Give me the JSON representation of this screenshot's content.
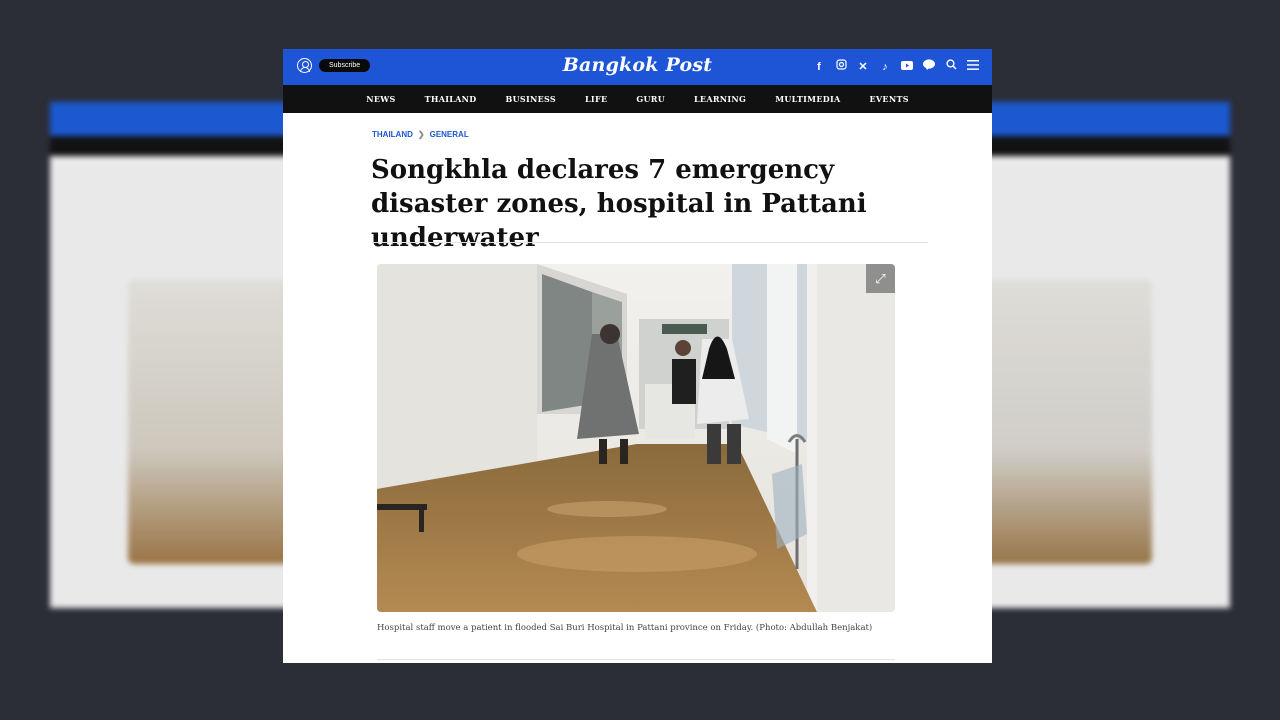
{
  "header": {
    "subscribe_label": "Subscribe",
    "logo": "Bangkok Post",
    "social_icons": [
      "facebook-icon",
      "instagram-icon",
      "x-icon",
      "tiktok-icon",
      "youtube-icon",
      "line-icon",
      "search-icon",
      "menu-icon"
    ]
  },
  "nav": {
    "items": [
      "NEWS",
      "THAILAND",
      "BUSINESS",
      "LIFE",
      "GURU",
      "LEARNING",
      "MULTIMEDIA",
      "EVENTS"
    ]
  },
  "breadcrumb": {
    "section": "THAILAND",
    "subsection": "GENERAL"
  },
  "article": {
    "headline": "Songkhla declares 7 emergency disaster zones, hospital in Pattani underwater",
    "caption": "Hospital staff move a patient in flooded Sai Buri Hospital in Pattani province on Friday. (Photo: Abdullah Benjakat)"
  },
  "colors": {
    "brand_blue": "#1d55d6",
    "nav_black": "#111111",
    "backdrop": "#2b2d37"
  }
}
